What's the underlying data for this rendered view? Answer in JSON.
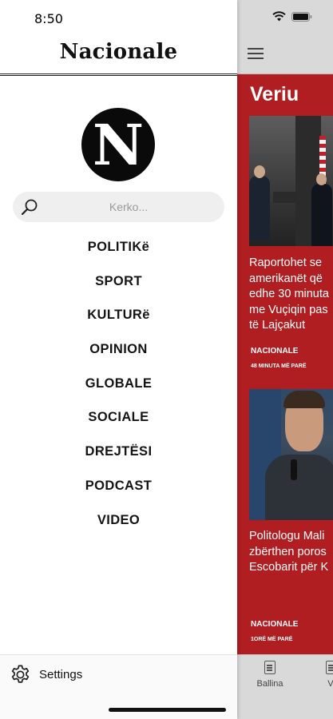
{
  "status_bar": {
    "time": "8:50"
  },
  "drawer": {
    "brand_title": "Nacionale",
    "logo_letter": "N",
    "search": {
      "placeholder": "Kerko...",
      "value": ""
    },
    "menu_items": [
      "POLITIKë",
      "SPORT",
      "KULTURë",
      "OPINION",
      "GLOBALE",
      "SOCIALE",
      "DREJTËSI",
      "PODCAST",
      "VIDEO"
    ],
    "settings_label": "Settings"
  },
  "background_app": {
    "section_title": "Veriu",
    "articles": [
      {
        "headline_lines": [
          "Raportohet se",
          "amerikanët që",
          "edhe 30 minuta",
          "me Vuçiqin pas",
          "të Lajçakut"
        ],
        "source": "NACIONALE",
        "time": "48 MINUTA MË PARË"
      },
      {
        "headline_lines": [
          "Politologu Mali",
          "zbërthen poros",
          "Escobarit për K"
        ],
        "source": "NACIONALE",
        "time": "1ORË MË PARË"
      }
    ],
    "tabs": [
      {
        "label": "Ballina",
        "icon": "document-icon"
      },
      {
        "label": "Vi",
        "icon": "video-icon"
      }
    ]
  },
  "colors": {
    "accent": "#b01e22",
    "drawer_bg": "#ffffff",
    "search_bg": "#efefef",
    "toolbar_bg": "#d9d9d9"
  }
}
